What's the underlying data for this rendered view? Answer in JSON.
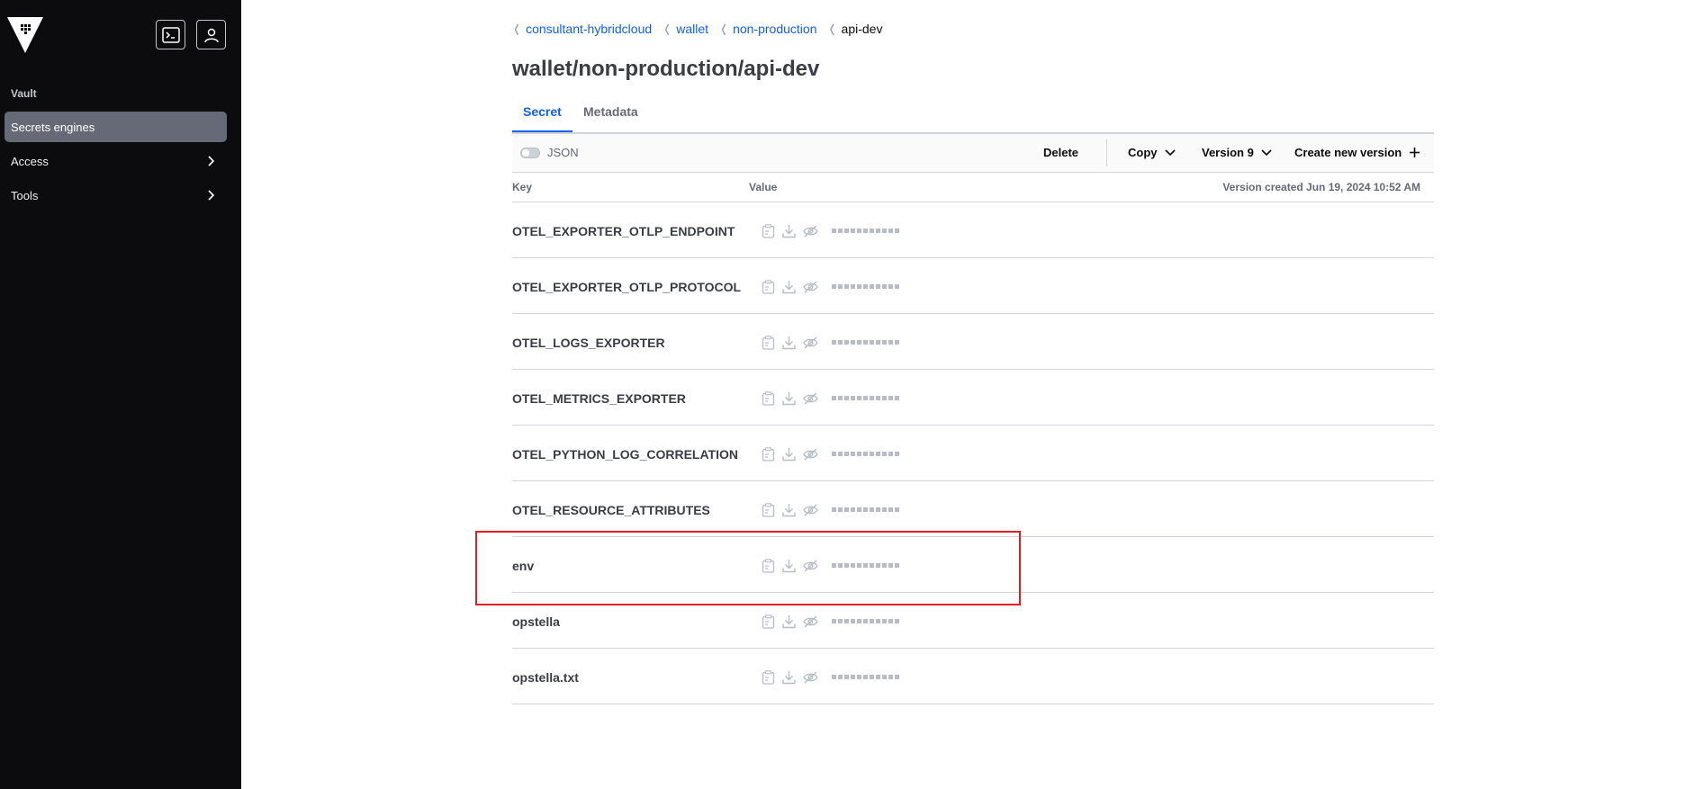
{
  "sidebar": {
    "heading": "Vault",
    "items": [
      {
        "label": "Secrets engines",
        "active": true
      },
      {
        "label": "Access",
        "active": false
      },
      {
        "label": "Tools",
        "active": false
      }
    ]
  },
  "breadcrumb": [
    "consultant-hybridcloud",
    "wallet",
    "non-production",
    "api-dev"
  ],
  "page_title": "wallet/non-production/api-dev",
  "tabs": [
    {
      "label": "Secret"
    },
    {
      "label": "Metadata"
    }
  ],
  "toolbar": {
    "json_label": "JSON",
    "delete_label": "Delete",
    "copy_label": "Copy",
    "version_label": "Version 9",
    "create_label": "Create new version"
  },
  "table": {
    "key_header": "Key",
    "value_header": "Value",
    "version_created": "Version created Jun 19, 2024 10:52 AM",
    "rows": [
      {
        "key": "OTEL_EXPORTER_OTLP_ENDPOINT"
      },
      {
        "key": "OTEL_EXPORTER_OTLP_PROTOCOL"
      },
      {
        "key": "OTEL_LOGS_EXPORTER"
      },
      {
        "key": "OTEL_METRICS_EXPORTER"
      },
      {
        "key": "OTEL_PYTHON_LOG_CORRELATION"
      },
      {
        "key": "OTEL_RESOURCE_ATTRIBUTES"
      },
      {
        "key": "env"
      },
      {
        "key": "opstella"
      },
      {
        "key": "opstella.txt"
      }
    ]
  },
  "colors": {
    "accent": "#1060ff",
    "sidebar": "#0c0c0e",
    "highlight": "#e01d28"
  },
  "icons": [
    "vault-logo-icon",
    "terminal-icon",
    "user-icon",
    "chevron-right-icon",
    "chevron-down-icon",
    "plus-icon",
    "copy-icon",
    "download-icon",
    "eye-off-icon"
  ]
}
